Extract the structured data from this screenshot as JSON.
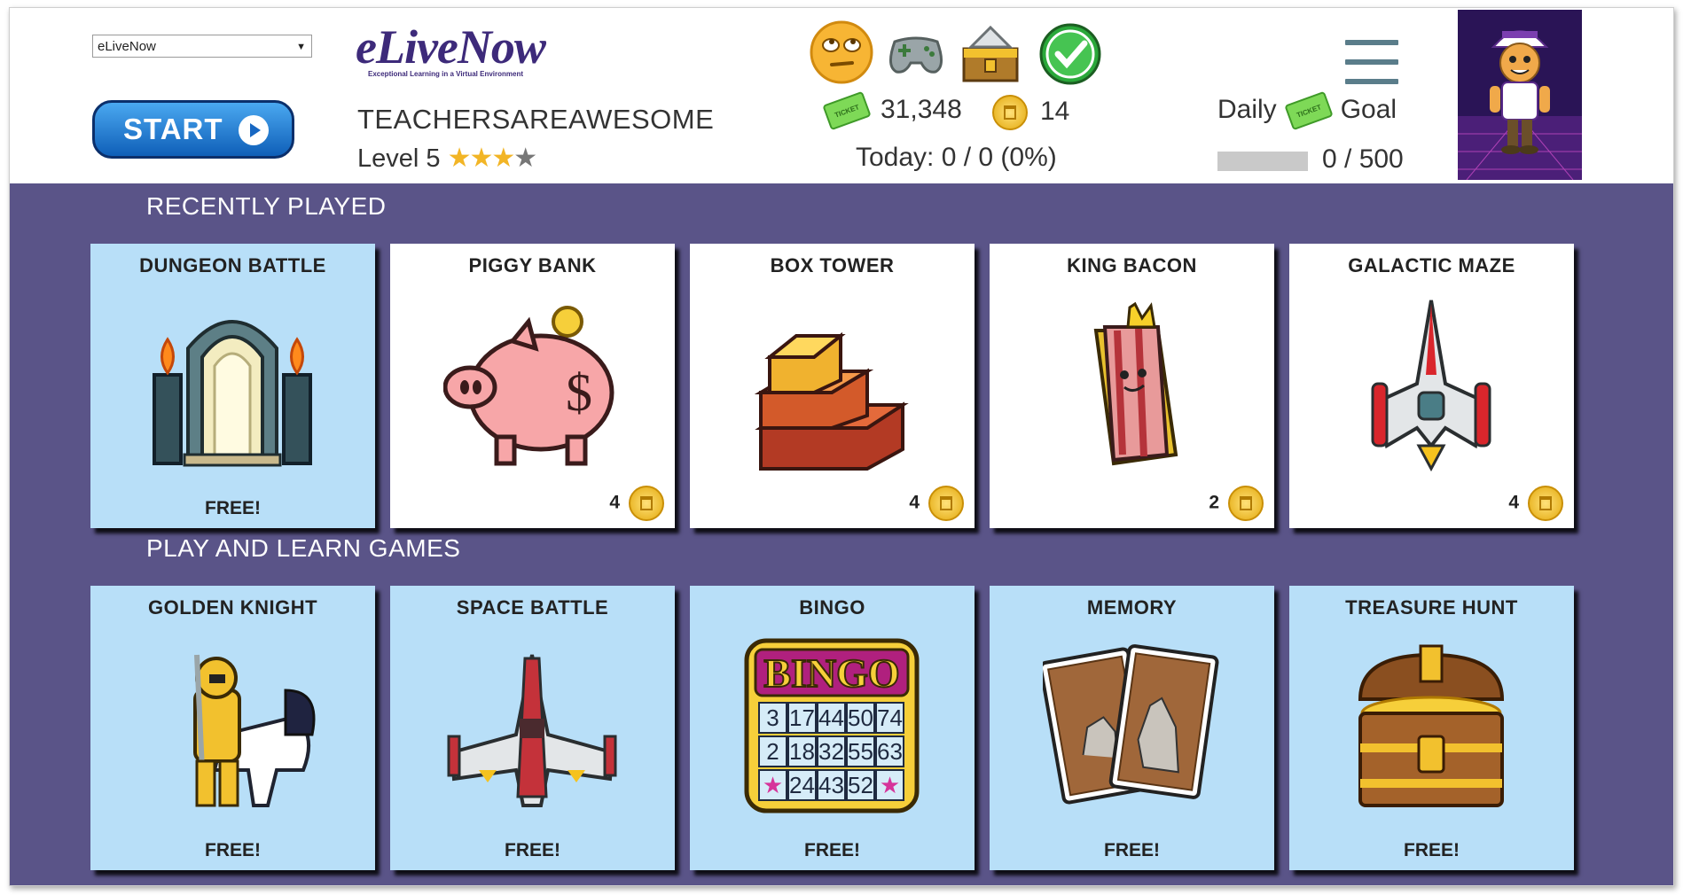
{
  "header": {
    "select_value": "eLiveNow",
    "start_label": "START",
    "logo_word": "eLiveNow",
    "logo_tagline": "Exceptional Learning in a Virtual Environment",
    "username": "TEACHERSAREAWESOME",
    "level_label": "Level 5",
    "stars_filled": 3,
    "stars_total": 4,
    "tickets": "31,348",
    "coins": "14",
    "today": "Today: 0 / 0 (0%)",
    "daily_label": "Daily",
    "goal_label": "Goal",
    "goal_text": "0 / 500",
    "goal_progress": 0,
    "top_icons": [
      "eye-roll-face-icon",
      "gamepad-icon",
      "treasure-bank-icon",
      "green-check-icon"
    ]
  },
  "recently_played": {
    "title": "RECENTLY PLAYED",
    "cards": [
      {
        "title": "DUNGEON BATTLE",
        "price": "FREE!",
        "free": true,
        "icon": "dungeon-door-icon"
      },
      {
        "title": "PIGGY BANK",
        "price": "4",
        "free": false,
        "icon": "piggy-bank-icon"
      },
      {
        "title": "BOX TOWER",
        "price": "4",
        "free": false,
        "icon": "box-tower-icon"
      },
      {
        "title": "KING BACON",
        "price": "2",
        "free": false,
        "icon": "king-bacon-icon"
      },
      {
        "title": "GALACTIC MAZE",
        "price": "4",
        "free": false,
        "icon": "spaceship-icon"
      }
    ]
  },
  "play_and_learn": {
    "title": "PLAY AND LEARN GAMES",
    "cards": [
      {
        "title": "GOLDEN KNIGHT",
        "price": "FREE!",
        "free": true,
        "icon": "golden-knight-icon"
      },
      {
        "title": "SPACE BATTLE",
        "price": "FREE!",
        "free": true,
        "icon": "space-fighter-icon"
      },
      {
        "title": "BINGO",
        "price": "FREE!",
        "free": true,
        "icon": "bingo-card-icon",
        "bingo_word": "BINGO",
        "bingo_numbers": [
          "3",
          "17",
          "44",
          "50",
          "74",
          "2",
          "18",
          "32",
          "55",
          "63",
          "24",
          "43",
          "52"
        ]
      },
      {
        "title": "MEMORY",
        "price": "FREE!",
        "free": true,
        "icon": "memory-cards-icon"
      },
      {
        "title": "TREASURE HUNT",
        "price": "FREE!",
        "free": true,
        "icon": "treasure-chest-icon"
      }
    ]
  },
  "colors": {
    "main_bg": "#5a5488",
    "free_card_bg": "#b8dff8",
    "paid_card_bg": "#ffffff",
    "start_button": "#1767c2",
    "brand": "#3d2a7a"
  }
}
